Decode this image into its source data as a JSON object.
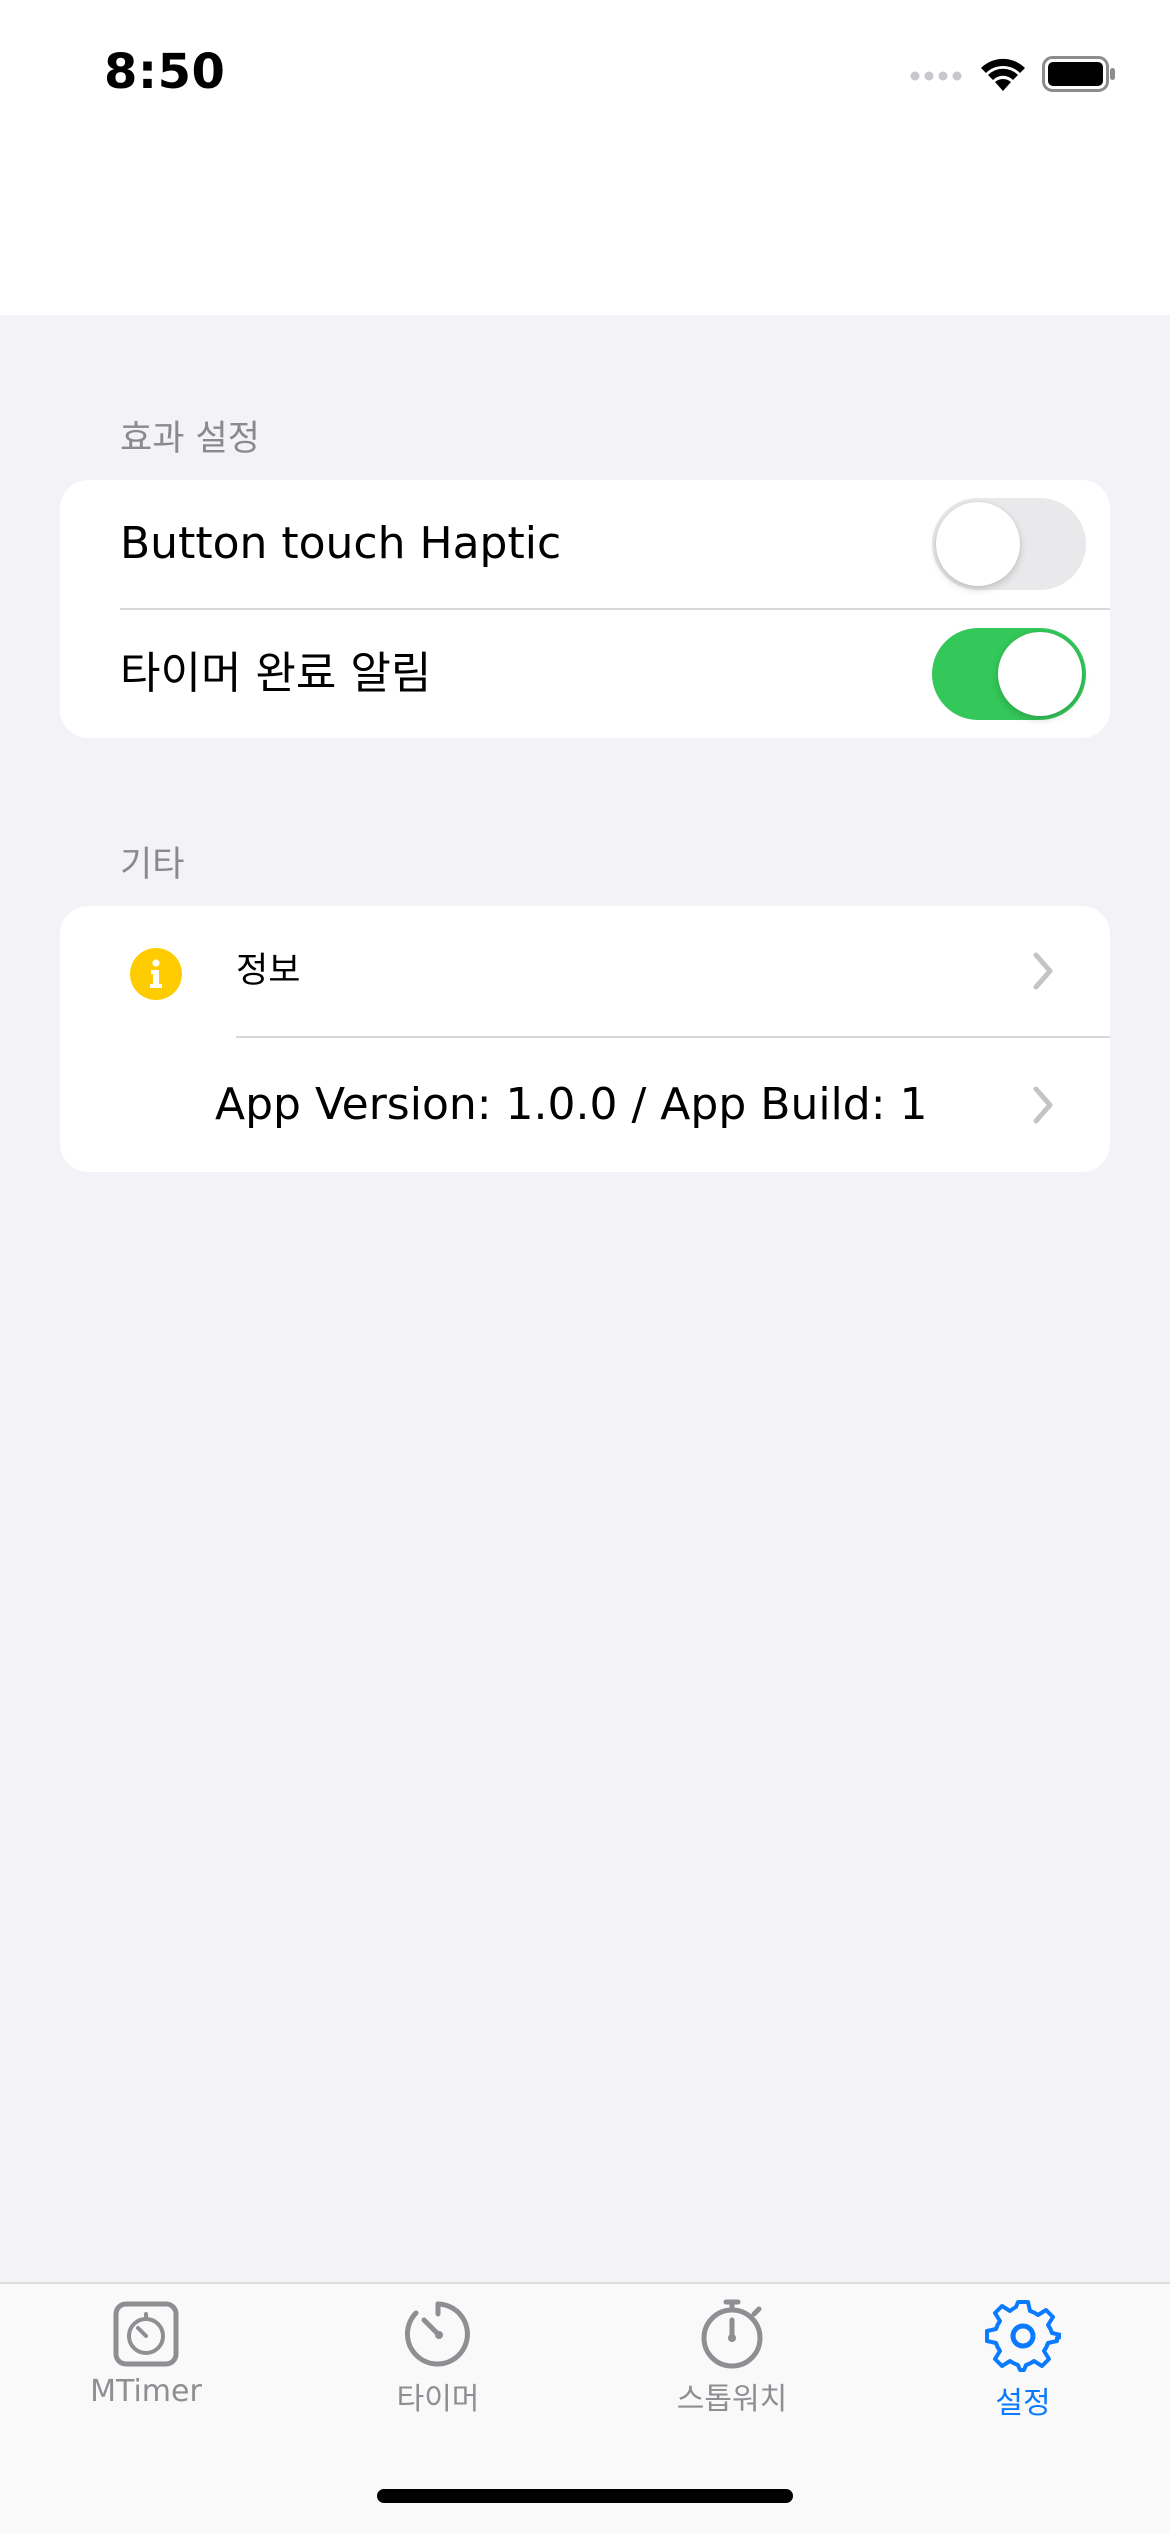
{
  "status_bar": {
    "time": "8:50"
  },
  "sections": {
    "effects": {
      "header": "효과 설정",
      "rows": [
        {
          "label": "Button touch Haptic",
          "enabled": false
        },
        {
          "label": "타이머 완료 알림",
          "enabled": true
        }
      ]
    },
    "other": {
      "header": "기타",
      "info_label": "정보",
      "version_label": "App Version: 1.0.0 / App Build: 1"
    }
  },
  "tab_bar": {
    "tabs": [
      {
        "label": "MTimer",
        "icon": "mtimer-icon",
        "active": false
      },
      {
        "label": "타이머",
        "icon": "timer-icon",
        "active": false
      },
      {
        "label": "스톱워치",
        "icon": "stopwatch-icon",
        "active": false
      },
      {
        "label": "설정",
        "icon": "gear-icon",
        "active": true
      }
    ]
  },
  "colors": {
    "accent": "#0a7aff",
    "toggle_on": "#34c759",
    "toggle_off": "#e9e9eb",
    "info_icon": "#fecc00",
    "background": "#f2f2f7",
    "secondary_text": "#8a8a8e",
    "inactive_tab": "#8e8e93"
  }
}
